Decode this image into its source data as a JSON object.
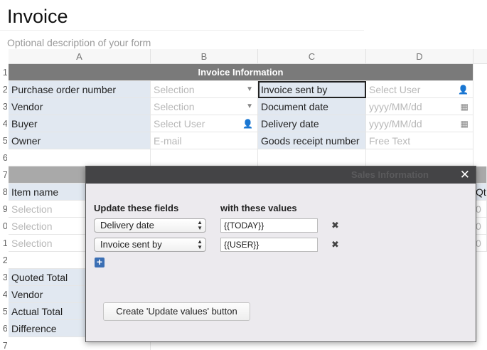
{
  "form": {
    "title": "Invoice",
    "description": "Optional description of your form"
  },
  "grid": {
    "columns": [
      "A",
      "B",
      "C",
      "D"
    ],
    "row_numbers": [
      "1",
      "2",
      "3",
      "4",
      "5",
      "6",
      "7",
      "8",
      "9",
      "0",
      "1",
      "2",
      "3",
      "4",
      "5",
      "6",
      "7"
    ],
    "invoice_header": "Invoice Information",
    "sales_header": "Sales Information",
    "rows": {
      "r2": {
        "a": "Purchase order number",
        "b": "Selection",
        "c": "Invoice sent by",
        "d": "Select User"
      },
      "r3": {
        "a": "Vendor",
        "b": "Selection",
        "c": "Document date",
        "d": "yyyy/MM/dd"
      },
      "r4": {
        "a": "Buyer",
        "b": "Select User",
        "c": "Delivery date",
        "d": "yyyy/MM/dd"
      },
      "r5": {
        "a": "Owner",
        "b": "E-mail",
        "c": "Goods receipt number",
        "d": "Free Text"
      }
    },
    "left_lower": {
      "item_name": "Item name",
      "selection_1": "Selection",
      "selection_2": "Selection",
      "selection_3": "Selection",
      "quoted_total": "Quoted Total",
      "vendor": "Vendor",
      "actual_total": "Actual Total",
      "difference": "Difference"
    },
    "right_lower": {
      "qty_header": "Qt",
      "z1": "0",
      "z2": "0",
      "z3": "0"
    }
  },
  "dialog": {
    "close_symbol": "✕",
    "col1_label": "Update these fields",
    "col2_label": "with these values",
    "rows": [
      {
        "field": "Delivery date",
        "value": "{{TODAY}}"
      },
      {
        "field": "Invoice sent by",
        "value": "{{USER}}"
      }
    ],
    "remove_symbol": "✖",
    "add_symbol": "+",
    "create_button": "Create 'Update values' button"
  },
  "icons": {
    "dropdown": "caret-down-icon",
    "person": "user-icon",
    "calendar": "calendar-icon"
  },
  "colors": {
    "label_bg": "#e1e8f1",
    "header_bar": "#7a7a7a",
    "dialog_header": "#444446",
    "dialog_bg": "#eceaee",
    "add_button": "#3b6fb4"
  }
}
